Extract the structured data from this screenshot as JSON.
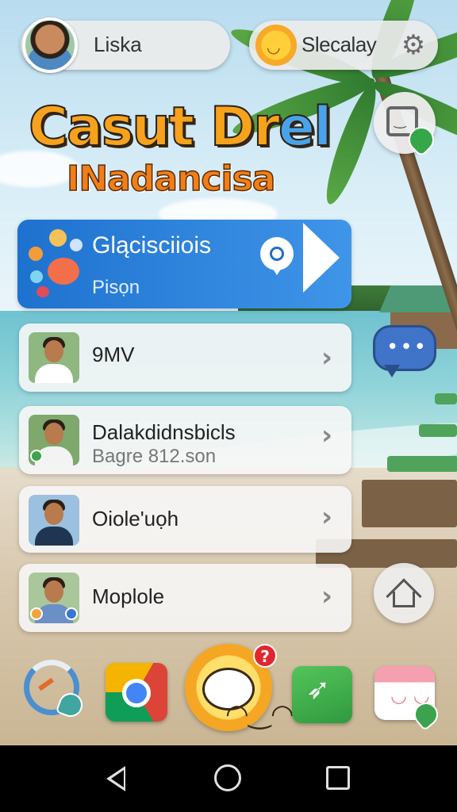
{
  "header": {
    "profile_name": "Liska",
    "status_name": "Slecalay"
  },
  "headline": {
    "line1_part1": "Casut Dr",
    "line1_part2": "el",
    "line2": "INadancisa"
  },
  "featured": {
    "title": "Glącisciiois",
    "subtitle": "Pisọn"
  },
  "list_items": [
    {
      "title": "9MV",
      "subtitle": ""
    },
    {
      "title": "Dalakdidnsbicls",
      "subtitle": "Bagre 812.son"
    },
    {
      "title": "Oiole'uọh",
      "subtitle": ""
    },
    {
      "title": "Moplole",
      "subtitle": ""
    }
  ],
  "dock": {
    "badge_count": "?"
  },
  "icons": {
    "settings": "gear-icon",
    "sticker": "sticker-icon",
    "chat": "chat-bubble-icon",
    "home": "home-icon",
    "chevron": "chevron-right-icon",
    "play": "play-icon",
    "pin": "location-pin-icon"
  },
  "colors": {
    "featured_card": "#2d84dc",
    "headline_orange": "#f6a21c",
    "badge_red": "#e3262e"
  }
}
